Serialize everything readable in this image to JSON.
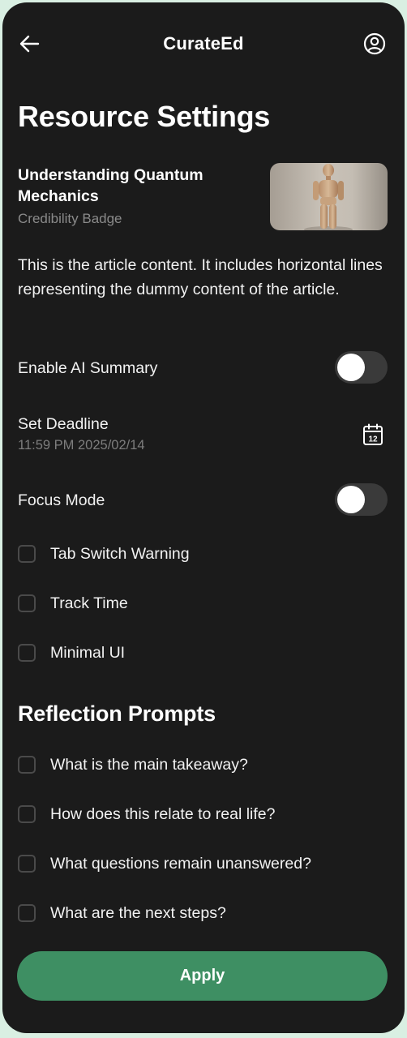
{
  "header": {
    "app_title": "CurateEd",
    "back_icon": "arrow-left-icon",
    "profile_icon": "user-circle-icon"
  },
  "page_title": "Resource Settings",
  "article": {
    "title": "Understanding Quantum Mechanics",
    "badge": "Credibility Badge",
    "thumbnail": "wooden-mannequin-image",
    "content": "This is the article content. It includes horizontal lines representing the dummy content of the article."
  },
  "settings": {
    "ai_summary": {
      "label": "Enable AI Summary",
      "enabled": false
    },
    "deadline": {
      "label": "Set Deadline",
      "value": "11:59 PM 2025/02/14",
      "icon": "calendar-icon"
    },
    "focus_mode": {
      "label": "Focus Mode",
      "enabled": false,
      "options": [
        {
          "label": "Tab Switch Warning",
          "checked": false
        },
        {
          "label": "Track Time",
          "checked": false
        },
        {
          "label": "Minimal UI",
          "checked": false
        }
      ]
    }
  },
  "reflection": {
    "title": "Reflection Prompts",
    "prompts": [
      {
        "label": "What is the main takeaway?",
        "checked": false
      },
      {
        "label": "How does this relate to real life?",
        "checked": false
      },
      {
        "label": "What questions remain unanswered?",
        "checked": false
      },
      {
        "label": "What are the next steps?",
        "checked": false
      }
    ]
  },
  "apply_label": "Apply",
  "colors": {
    "background": "#d9efe2",
    "surface": "#1b1b1b",
    "accent": "#3e8f63",
    "muted_text": "#8a8a8a"
  }
}
